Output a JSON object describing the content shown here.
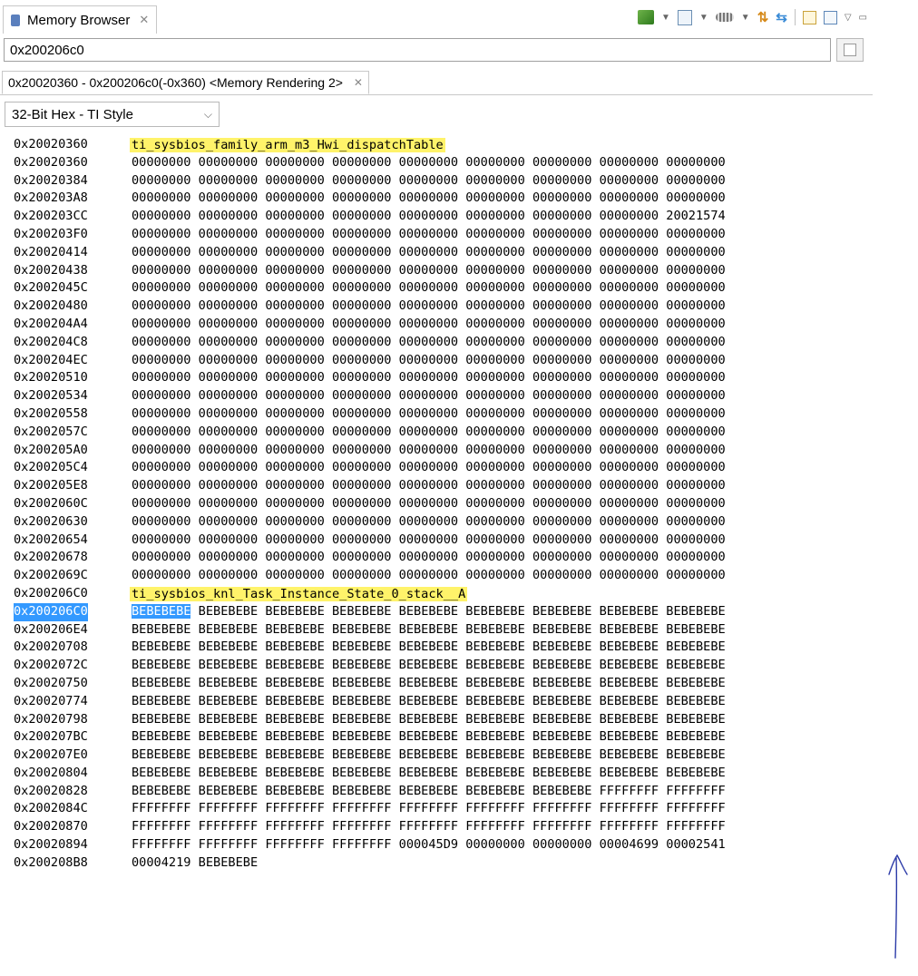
{
  "view": {
    "tab_title": "Memory Browser",
    "close_glyph": "✕",
    "icons": [
      "run-icon",
      "view-icon",
      "chip-icon",
      "refresh-icon",
      "sync-icon",
      "new-window-icon",
      "pin-icon",
      "view-menu-icon",
      "minimize-icon"
    ]
  },
  "address": {
    "value": "0x200206c0"
  },
  "rendering": {
    "tab_label": "0x20020360 - 0x200206c0(-0x360) <Memory Rendering 2>",
    "close_glyph": "✕",
    "format_value": "32-Bit Hex - TI Style"
  },
  "rows": [
    {
      "addr": "0x20020360",
      "label": "ti_sysbios_family_arm_m3_Hwi_dispatchTable"
    },
    {
      "addr": "0x20020360",
      "words": "00000000 00000000 00000000 00000000 00000000 00000000 00000000 00000000 00000000"
    },
    {
      "addr": "0x20020384",
      "words": "00000000 00000000 00000000 00000000 00000000 00000000 00000000 00000000 00000000"
    },
    {
      "addr": "0x200203A8",
      "words": "00000000 00000000 00000000 00000000 00000000 00000000 00000000 00000000 00000000"
    },
    {
      "addr": "0x200203CC",
      "words": "00000000 00000000 00000000 00000000 00000000 00000000 00000000 00000000 20021574"
    },
    {
      "addr": "0x200203F0",
      "words": "00000000 00000000 00000000 00000000 00000000 00000000 00000000 00000000 00000000"
    },
    {
      "addr": "0x20020414",
      "words": "00000000 00000000 00000000 00000000 00000000 00000000 00000000 00000000 00000000"
    },
    {
      "addr": "0x20020438",
      "words": "00000000 00000000 00000000 00000000 00000000 00000000 00000000 00000000 00000000"
    },
    {
      "addr": "0x2002045C",
      "words": "00000000 00000000 00000000 00000000 00000000 00000000 00000000 00000000 00000000"
    },
    {
      "addr": "0x20020480",
      "words": "00000000 00000000 00000000 00000000 00000000 00000000 00000000 00000000 00000000"
    },
    {
      "addr": "0x200204A4",
      "words": "00000000 00000000 00000000 00000000 00000000 00000000 00000000 00000000 00000000"
    },
    {
      "addr": "0x200204C8",
      "words": "00000000 00000000 00000000 00000000 00000000 00000000 00000000 00000000 00000000"
    },
    {
      "addr": "0x200204EC",
      "words": "00000000 00000000 00000000 00000000 00000000 00000000 00000000 00000000 00000000"
    },
    {
      "addr": "0x20020510",
      "words": "00000000 00000000 00000000 00000000 00000000 00000000 00000000 00000000 00000000"
    },
    {
      "addr": "0x20020534",
      "words": "00000000 00000000 00000000 00000000 00000000 00000000 00000000 00000000 00000000"
    },
    {
      "addr": "0x20020558",
      "words": "00000000 00000000 00000000 00000000 00000000 00000000 00000000 00000000 00000000"
    },
    {
      "addr": "0x2002057C",
      "words": "00000000 00000000 00000000 00000000 00000000 00000000 00000000 00000000 00000000"
    },
    {
      "addr": "0x200205A0",
      "words": "00000000 00000000 00000000 00000000 00000000 00000000 00000000 00000000 00000000"
    },
    {
      "addr": "0x200205C4",
      "words": "00000000 00000000 00000000 00000000 00000000 00000000 00000000 00000000 00000000"
    },
    {
      "addr": "0x200205E8",
      "words": "00000000 00000000 00000000 00000000 00000000 00000000 00000000 00000000 00000000"
    },
    {
      "addr": "0x2002060C",
      "words": "00000000 00000000 00000000 00000000 00000000 00000000 00000000 00000000 00000000"
    },
    {
      "addr": "0x20020630",
      "words": "00000000 00000000 00000000 00000000 00000000 00000000 00000000 00000000 00000000"
    },
    {
      "addr": "0x20020654",
      "words": "00000000 00000000 00000000 00000000 00000000 00000000 00000000 00000000 00000000"
    },
    {
      "addr": "0x20020678",
      "words": "00000000 00000000 00000000 00000000 00000000 00000000 00000000 00000000 00000000"
    },
    {
      "addr": "0x2002069C",
      "words": "00000000 00000000 00000000 00000000 00000000 00000000 00000000 00000000 00000000"
    },
    {
      "addr": "0x200206C0",
      "label": "ti_sysbios_knl_Task_Instance_State_0_stack__A"
    },
    {
      "addr": "0x200206C0",
      "selected": true,
      "first_word": "BEBEBEBE",
      "words": " BEBEBEBE BEBEBEBE BEBEBEBE BEBEBEBE BEBEBEBE BEBEBEBE BEBEBEBE BEBEBEBE"
    },
    {
      "addr": "0x200206E4",
      "words": "BEBEBEBE BEBEBEBE BEBEBEBE BEBEBEBE BEBEBEBE BEBEBEBE BEBEBEBE BEBEBEBE BEBEBEBE"
    },
    {
      "addr": "0x20020708",
      "words": "BEBEBEBE BEBEBEBE BEBEBEBE BEBEBEBE BEBEBEBE BEBEBEBE BEBEBEBE BEBEBEBE BEBEBEBE"
    },
    {
      "addr": "0x2002072C",
      "words": "BEBEBEBE BEBEBEBE BEBEBEBE BEBEBEBE BEBEBEBE BEBEBEBE BEBEBEBE BEBEBEBE BEBEBEBE"
    },
    {
      "addr": "0x20020750",
      "words": "BEBEBEBE BEBEBEBE BEBEBEBE BEBEBEBE BEBEBEBE BEBEBEBE BEBEBEBE BEBEBEBE BEBEBEBE"
    },
    {
      "addr": "0x20020774",
      "words": "BEBEBEBE BEBEBEBE BEBEBEBE BEBEBEBE BEBEBEBE BEBEBEBE BEBEBEBE BEBEBEBE BEBEBEBE"
    },
    {
      "addr": "0x20020798",
      "words": "BEBEBEBE BEBEBEBE BEBEBEBE BEBEBEBE BEBEBEBE BEBEBEBE BEBEBEBE BEBEBEBE BEBEBEBE"
    },
    {
      "addr": "0x200207BC",
      "words": "BEBEBEBE BEBEBEBE BEBEBEBE BEBEBEBE BEBEBEBE BEBEBEBE BEBEBEBE BEBEBEBE BEBEBEBE"
    },
    {
      "addr": "0x200207E0",
      "words": "BEBEBEBE BEBEBEBE BEBEBEBE BEBEBEBE BEBEBEBE BEBEBEBE BEBEBEBE BEBEBEBE BEBEBEBE"
    },
    {
      "addr": "0x20020804",
      "words": "BEBEBEBE BEBEBEBE BEBEBEBE BEBEBEBE BEBEBEBE BEBEBEBE BEBEBEBE BEBEBEBE BEBEBEBE"
    },
    {
      "addr": "0x20020828",
      "words": "BEBEBEBE BEBEBEBE BEBEBEBE BEBEBEBE BEBEBEBE BEBEBEBE BEBEBEBE FFFFFFFF FFFFFFFF"
    },
    {
      "addr": "0x2002084C",
      "words": "FFFFFFFF FFFFFFFF FFFFFFFF FFFFFFFF FFFFFFFF FFFFFFFF FFFFFFFF FFFFFFFF FFFFFFFF"
    },
    {
      "addr": "0x20020870",
      "words": "FFFFFFFF FFFFFFFF FFFFFFFF FFFFFFFF FFFFFFFF FFFFFFFF FFFFFFFF FFFFFFFF FFFFFFFF"
    },
    {
      "addr": "0x20020894",
      "words": "FFFFFFFF FFFFFFFF FFFFFFFF FFFFFFFF 000045D9 00000000 00000000 00004699 00002541"
    },
    {
      "addr": "0x200208B8",
      "words": "00004219 BEBEBEBE"
    }
  ],
  "colors": {
    "label_highlight": "#fff36a",
    "selection": "#3399ff",
    "annotation_pen": "#2b3aa8"
  }
}
